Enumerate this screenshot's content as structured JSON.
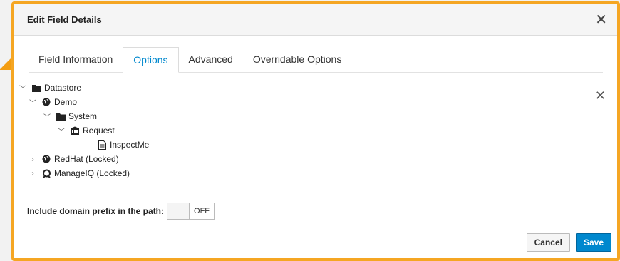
{
  "dialog": {
    "title": "Edit Field Details"
  },
  "tabs": [
    {
      "label": "Field Information"
    },
    {
      "label": "Options"
    },
    {
      "label": "Advanced"
    },
    {
      "label": "Overridable Options"
    }
  ],
  "tree": [
    {
      "label": "Datastore",
      "icon": "folder-icon",
      "expanded": true
    },
    {
      "label": "Demo",
      "icon": "globe-icon",
      "expanded": true
    },
    {
      "label": "System",
      "icon": "folder-icon",
      "expanded": true
    },
    {
      "label": "Request",
      "icon": "class-icon",
      "expanded": true
    },
    {
      "label": "InspectMe",
      "icon": "document-icon"
    },
    {
      "label": "RedHat (Locked)",
      "icon": "globe-icon",
      "expanded": false
    },
    {
      "label": "ManageIQ (Locked)",
      "icon": "manageiq-icon",
      "expanded": false
    }
  ],
  "options": {
    "prefix_label": "Include domain prefix in the path:",
    "prefix_toggle": "OFF"
  },
  "footer": {
    "cancel_label": "Cancel",
    "save_label": "Save"
  },
  "colors": {
    "accent": "#0088ce",
    "highlight_border": "#f5a623"
  }
}
